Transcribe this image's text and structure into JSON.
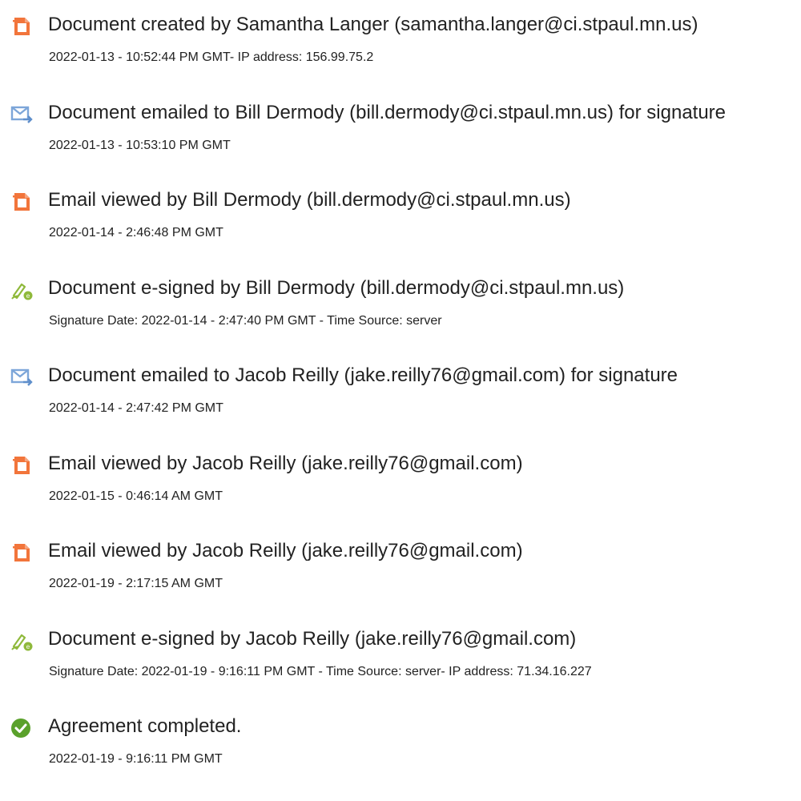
{
  "events": [
    {
      "icon": "document-created-icon",
      "title": "Document created by Samantha Langer (samantha.langer@ci.stpaul.mn.us)",
      "detail": "2022-01-13 - 10:52:44 PM GMT- IP address: 156.99.75.2"
    },
    {
      "icon": "email-sent-icon",
      "title": "Document emailed to Bill Dermody (bill.dermody@ci.stpaul.mn.us) for signature",
      "detail": "2022-01-13 - 10:53:10 PM GMT"
    },
    {
      "icon": "document-viewed-icon",
      "title": "Email viewed by Bill Dermody (bill.dermody@ci.stpaul.mn.us)",
      "detail": "2022-01-14 - 2:46:48 PM GMT"
    },
    {
      "icon": "esign-pen-icon",
      "title": "Document e-signed by Bill Dermody (bill.dermody@ci.stpaul.mn.us)",
      "detail": "Signature Date: 2022-01-14 - 2:47:40 PM GMT - Time Source: server"
    },
    {
      "icon": "email-sent-icon",
      "title": "Document emailed to Jacob Reilly (jake.reilly76@gmail.com) for signature",
      "detail": "2022-01-14 - 2:47:42 PM GMT"
    },
    {
      "icon": "document-viewed-icon",
      "title": "Email viewed by Jacob Reilly (jake.reilly76@gmail.com)",
      "detail": "2022-01-15 - 0:46:14 AM GMT"
    },
    {
      "icon": "document-viewed-icon",
      "title": "Email viewed by Jacob Reilly (jake.reilly76@gmail.com)",
      "detail": "2022-01-19 - 2:17:15 AM GMT"
    },
    {
      "icon": "esign-pen-icon",
      "title": "Document e-signed by Jacob Reilly (jake.reilly76@gmail.com)",
      "detail": "Signature Date: 2022-01-19 - 9:16:11 PM GMT - Time Source: server- IP address: 71.34.16.227"
    },
    {
      "icon": "completed-check-icon",
      "title": "Agreement completed.",
      "detail": "2022-01-19 - 9:16:11 PM GMT"
    }
  ],
  "colors": {
    "document_icon": "#f2753b",
    "email_icon": "#7da6d9",
    "esign_icon": "#8fb93b",
    "completed_icon": "#5aa12b"
  }
}
